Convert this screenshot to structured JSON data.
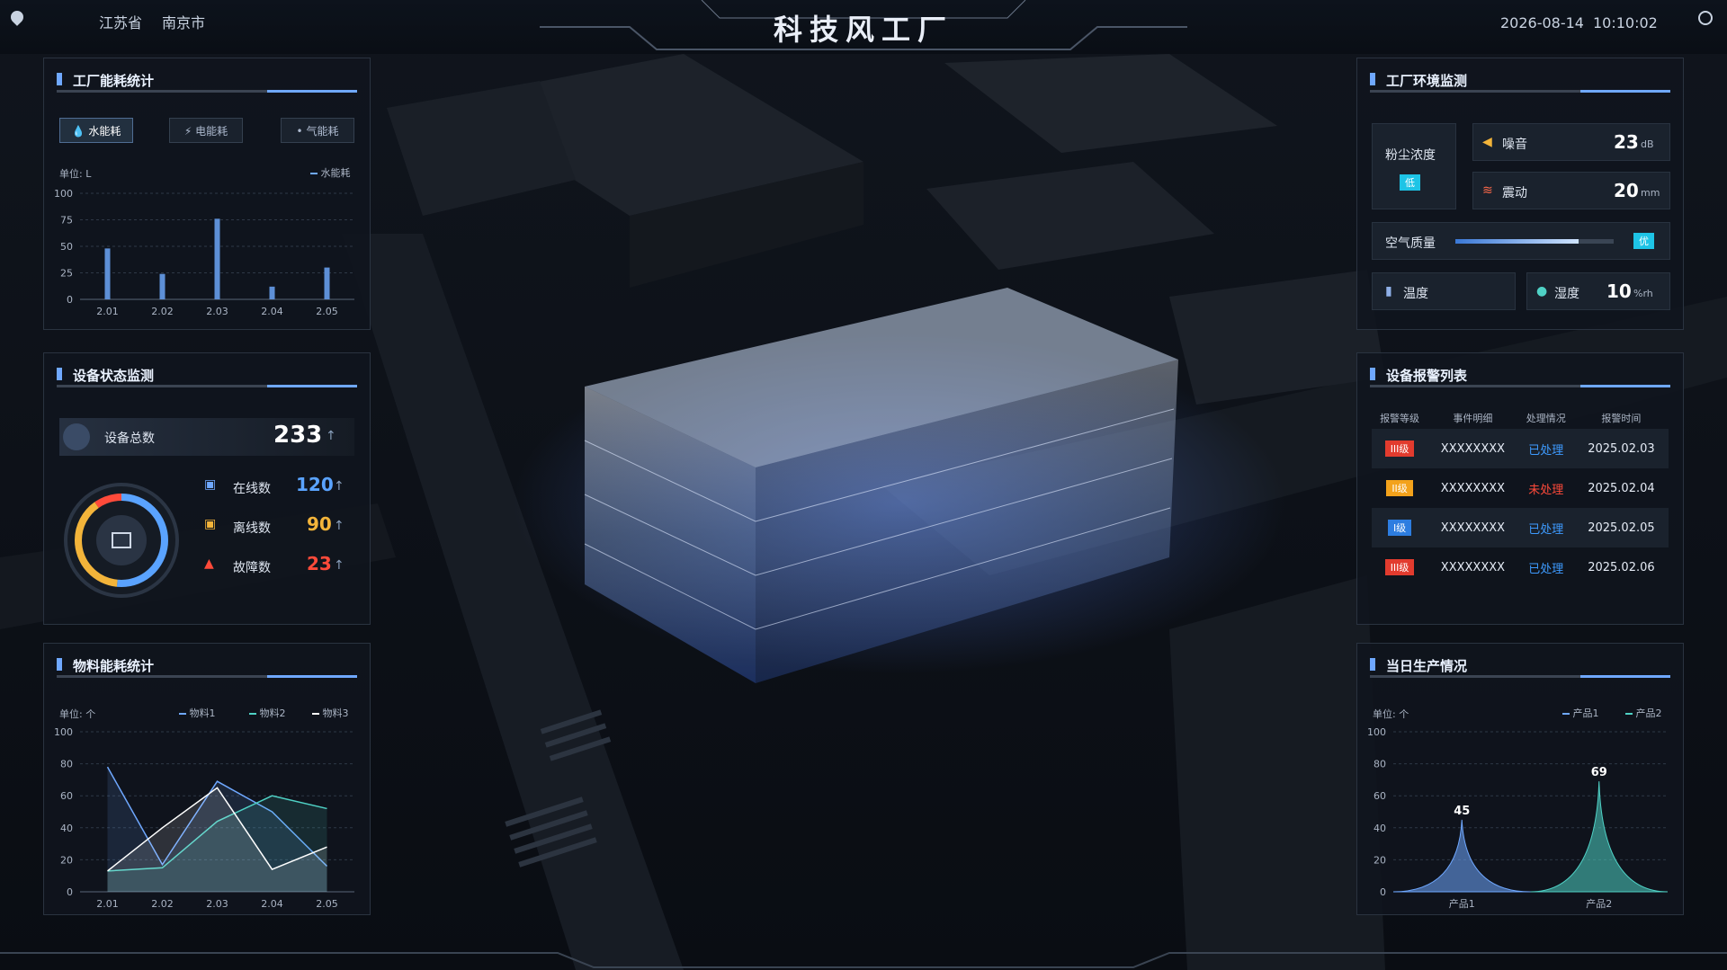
{
  "header": {
    "title": "科技风工厂",
    "province": "江苏省",
    "city": "南京市",
    "date": "2026-08-14",
    "time": "10:10:02"
  },
  "energy_panel": {
    "title": "工厂能耗统计",
    "tabs": [
      "水能耗",
      "电能耗",
      "气能耗"
    ],
    "unit": "单位: L",
    "legend": "水能耗"
  },
  "device_panel": {
    "title": "设备状态监测",
    "total_label": "设备总数",
    "total_value": "233",
    "online_label": "在线数",
    "online_value": "120",
    "offline_label": "离线数",
    "offline_value": "90",
    "fault_label": "故障数",
    "fault_value": "23"
  },
  "material_panel": {
    "title": "物料能耗统计",
    "unit": "单位: 个",
    "legend": [
      "物料1",
      "物料2",
      "物料3"
    ]
  },
  "env_panel": {
    "title": "工厂环境监测",
    "dust_label": "粉尘浓度",
    "dust_level": "低",
    "noise_label": "噪音",
    "noise_value": "23",
    "noise_unit": "dB",
    "vibration_label": "震动",
    "vibration_value": "20",
    "vibration_unit": "mm",
    "air_label": "空气质量",
    "air_level": "优",
    "air_fraction": 0.78,
    "temp_label": "温度",
    "humidity_label": "湿度",
    "humidity_value": "10",
    "humidity_unit": "%rh"
  },
  "alarm_panel": {
    "title": "设备报警列表",
    "columns": [
      "报警等级",
      "事件明细",
      "处理情况",
      "报警时间"
    ],
    "rows": [
      {
        "level": "III级",
        "detail": "XXXXXXXX",
        "status": "已处理",
        "time": "2025.02.03",
        "level_color": "#e23b2e",
        "status_color": "#3e9bff"
      },
      {
        "level": "II级",
        "detail": "XXXXXXXX",
        "status": "未处理",
        "time": "2025.02.04",
        "level_color": "#f3a21b",
        "status_color": "#ff4a3a"
      },
      {
        "level": "I级",
        "detail": "XXXXXXXX",
        "status": "已处理",
        "time": "2025.02.05",
        "level_color": "#2d7de0",
        "status_color": "#3e9bff"
      },
      {
        "level": "III级",
        "detail": "XXXXXXXX",
        "status": "已处理",
        "time": "2025.02.06",
        "level_color": "#e23b2e",
        "status_color": "#3e9bff"
      }
    ]
  },
  "production_panel": {
    "title": "当日生产情况",
    "unit": "单位: 个",
    "legend": [
      "产品1",
      "产品2"
    ]
  },
  "colors": {
    "accent": "#6fa8ff",
    "teal": "#4fd1c5",
    "orange": "#f3b43a",
    "red": "#ff4a3a"
  },
  "chart_data": [
    {
      "type": "bar",
      "categories": [
        "2.01",
        "2.02",
        "2.03",
        "2.04",
        "2.05"
      ],
      "series": [
        {
          "name": "水能耗",
          "values": [
            48,
            24,
            76,
            12,
            30
          ]
        }
      ],
      "ylim": [
        0,
        100
      ],
      "yticks": [
        0,
        25,
        50,
        75,
        100
      ],
      "grid": true
    },
    {
      "type": "area",
      "categories": [
        "2.01",
        "2.02",
        "2.03",
        "2.04",
        "2.05"
      ],
      "series": [
        {
          "name": "物料1",
          "values": [
            78,
            17,
            69,
            50,
            16
          ]
        },
        {
          "name": "物料2",
          "values": [
            13,
            15,
            44,
            60,
            52
          ]
        },
        {
          "name": "物料3",
          "values": [
            13,
            40,
            65,
            14,
            28
          ]
        }
      ],
      "ylim": [
        0,
        100
      ],
      "yticks": [
        0,
        20,
        40,
        60,
        80,
        100
      ],
      "grid": true
    },
    {
      "type": "area",
      "categories": [
        "产品1",
        "产品2"
      ],
      "series": [
        {
          "name": "产品1",
          "values": [
            45
          ]
        },
        {
          "name": "产品2",
          "values": [
            69
          ]
        }
      ],
      "ylim": [
        0,
        100
      ],
      "yticks": [
        0,
        20,
        40,
        60,
        80,
        100
      ],
      "grid": true
    }
  ]
}
